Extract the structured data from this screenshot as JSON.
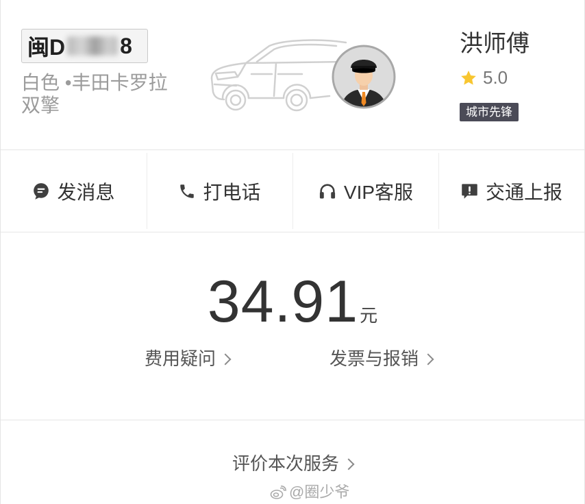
{
  "driver_card": {
    "plate_prefix": "闽D",
    "plate_suffix": "8",
    "car_info_line1": "白色 •丰田卡罗拉",
    "car_info_line2": "双擎",
    "driver_name": "洪师傅",
    "rating": "5.0",
    "badge": "城市先锋",
    "icons": {
      "car": "car-illustration",
      "avatar": "driver-avatar",
      "rating": "star-icon"
    }
  },
  "actions": [
    {
      "label": "发消息",
      "icon": "message-bubble-icon"
    },
    {
      "label": "打电话",
      "icon": "phone-icon"
    },
    {
      "label": "VIP客服",
      "icon": "headset-icon"
    },
    {
      "label": "交通上报",
      "icon": "traffic-report-icon"
    }
  ],
  "fare": {
    "amount": "34.91",
    "unit": "元",
    "fee_question": "费用疑问",
    "invoice": "发票与报销"
  },
  "rate_service": "评价本次服务",
  "watermark": "@圈少爷",
  "colors": {
    "badge_bg": "#4b4b57",
    "star": "#f8c630",
    "text_primary": "#333333",
    "text_secondary": "#9b9b9b",
    "divider": "#e6e6e6"
  }
}
